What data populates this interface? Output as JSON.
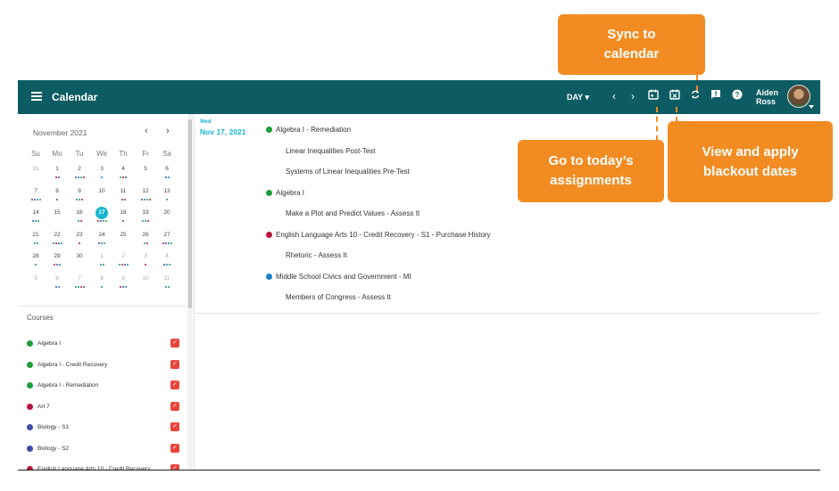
{
  "header": {
    "title": "Calendar",
    "view_label": "DAY",
    "user_name_first": "Aiden",
    "user_name_last": "Ross",
    "icons": [
      "menu-icon",
      "chevron-left-icon",
      "chevron-right-icon",
      "today-calendar-icon",
      "blackout-calendar-icon",
      "sync-icon",
      "feedback-icon",
      "help-icon"
    ]
  },
  "mini_calendar": {
    "month": "November 2021",
    "weekdays": [
      "Su",
      "Mo",
      "Tu",
      "We",
      "Th",
      "Fr",
      "Sa"
    ],
    "weeks": [
      [
        "31",
        "1",
        "2",
        "3",
        "4",
        "5",
        "6"
      ],
      [
        "7",
        "8",
        "9",
        "10",
        "11",
        "12",
        "13"
      ],
      [
        "14",
        "15",
        "16",
        "17",
        "18",
        "19",
        "20"
      ],
      [
        "21",
        "22",
        "23",
        "24",
        "25",
        "26",
        "27"
      ],
      [
        "28",
        "29",
        "30",
        "1",
        "2",
        "3",
        "4"
      ],
      [
        "5",
        "6",
        "7",
        "8",
        "9",
        "10",
        "11"
      ]
    ],
    "selected_day": "17"
  },
  "courses": {
    "title": "Courses",
    "items": [
      {
        "label": "Algebra I",
        "color": "#1e9e3a",
        "checked": true
      },
      {
        "label": "Algebra I - Credit Recovery",
        "color": "#1e9e3a",
        "checked": true
      },
      {
        "label": "Algebra I - Remediation",
        "color": "#1e9e3a",
        "checked": true
      },
      {
        "label": "Art 7",
        "color": "#b8143c",
        "checked": true
      },
      {
        "label": "Biology - S1",
        "color": "#3f4ba6",
        "checked": true
      },
      {
        "label": "Biology - S2",
        "color": "#3f4ba6",
        "checked": true
      },
      {
        "label": "English Language Arts 10 - Credit Recovery ...",
        "color": "#b8143c",
        "checked": true
      }
    ]
  },
  "agenda": {
    "dow": "Wed",
    "date": "Nov 17, 2021",
    "groups": [
      {
        "course": "Algebra I - Remediation",
        "color": "#1e9e3a",
        "items": [
          "Linear Inequalities Post-Test",
          "Systems of Linear Inequalities Pre-Test"
        ]
      },
      {
        "course": "Algebra I",
        "color": "#1e9e3a",
        "items": [
          "Make a Plot and Predict Values - Assess It"
        ]
      },
      {
        "course": "English Language Arts 10 - Credit Recovery - S1 - Purchase History",
        "color": "#b8143c",
        "items": [
          "Rhetoric - Assess It"
        ]
      },
      {
        "course": "Middle School Civics and Government - MI",
        "color": "#1c7fc9",
        "items": [
          "Members of Congress - Assess It"
        ]
      }
    ]
  },
  "callouts": {
    "sync": "Sync to calendar",
    "today": "Go to today’s assignments",
    "blackout": "View and apply blackout dates"
  },
  "colors": {
    "topbar": "#0d5c63",
    "accent": "#18b5d2",
    "callout": "#f28c22",
    "checkbox": "#e8453c"
  }
}
